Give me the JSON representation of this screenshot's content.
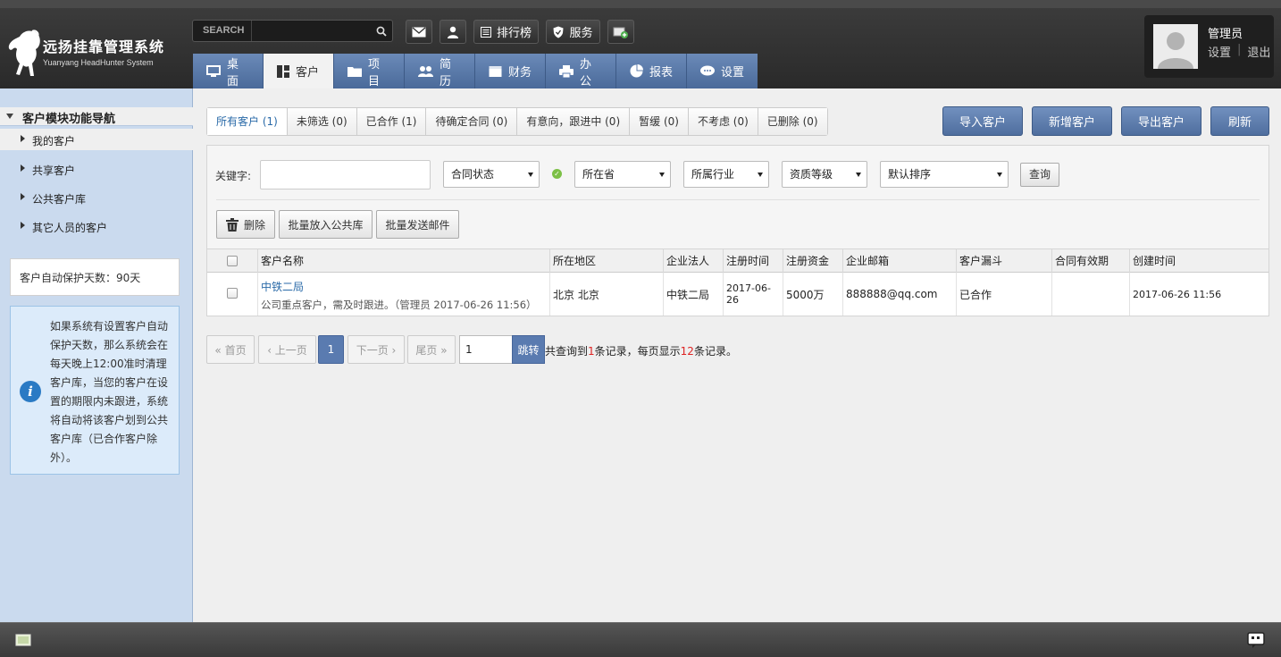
{
  "brand": {
    "title": "远扬挂靠管理系统",
    "subtitle": "Yuanyang HeadHunter System"
  },
  "search": {
    "label": "SEARCH",
    "value": ""
  },
  "top_buttons": [
    {
      "label": "",
      "icon": "mail-icon"
    },
    {
      "label": "",
      "icon": "user-icon"
    },
    {
      "label": "排行榜",
      "icon": "ranking-icon"
    },
    {
      "label": "服务",
      "icon": "shield-icon"
    },
    {
      "label": "",
      "icon": "add-screen-icon"
    }
  ],
  "user": {
    "name": "管理员",
    "settings": "设置",
    "logout": "退出"
  },
  "mainnav": [
    {
      "label": "桌面",
      "icon": "monitor-icon"
    },
    {
      "label": "客户",
      "icon": "grid-icon",
      "active": true
    },
    {
      "label": "项目",
      "icon": "folder-icon"
    },
    {
      "label": "简历",
      "icon": "users-icon"
    },
    {
      "label": "财务",
      "icon": "calendar-icon"
    },
    {
      "label": "办公",
      "icon": "printer-icon"
    },
    {
      "label": "报表",
      "icon": "pie-icon"
    },
    {
      "label": "设置",
      "icon": "chat-icon"
    }
  ],
  "sidebar": {
    "heading": "客户模块功能导航",
    "items": [
      "我的客户",
      "共享客户",
      "公共客户库",
      "其它人员的客户"
    ],
    "protect_days": "客户自动保护天数：90天",
    "info": "如果系统有设置客户自动保护天数，那么系统会在每天晚上12:00准时清理客户库，当您的客户在设置的期限内未跟进，系统将自动将该客户划到公共客户库（已合作客户除外）。"
  },
  "filter_tabs": [
    {
      "label": "所有客户 (1)",
      "active": true
    },
    {
      "label": "未筛选 (0)"
    },
    {
      "label": "已合作 (1)"
    },
    {
      "label": "待确定合同 (0)"
    },
    {
      "label": "有意向，跟进中 (0)"
    },
    {
      "label": "暂缓 (0)"
    },
    {
      "label": "不考虑 (0)"
    },
    {
      "label": "已删除 (0)"
    }
  ],
  "actions": {
    "import": "导入客户",
    "add": "新增客户",
    "export": "导出客户",
    "refresh": "刷新"
  },
  "filters": {
    "keyword_label": "关键字:",
    "keyword_value": "",
    "contract_status": "合同状态",
    "province": "所在省",
    "industry": "所属行业",
    "qualification": "资质等级",
    "sort": "默认排序",
    "query": "查询"
  },
  "bulk": {
    "delete": "删除",
    "to_public": "批量放入公共库",
    "send_mail": "批量发送邮件"
  },
  "table": {
    "headers": [
      "客户名称",
      "所在地区",
      "企业法人",
      "注册时间",
      "注册资金",
      "企业邮箱",
      "客户漏斗",
      "合同有效期",
      "创建时间"
    ],
    "rows": [
      {
        "name": "中铁二局",
        "desc": "公司重点客户，需及时跟进。（管理员 2017-06-26 11:56）",
        "region": "北京  北京",
        "legal": "中铁二局",
        "reg_date": "2017-06-26",
        "capital": "5000万",
        "email": "888888@qq.com",
        "funnel": "已合作",
        "contract": "",
        "created": "2017-06-26 11:56"
      }
    ]
  },
  "pagination": {
    "first": "« 首页",
    "prev": "‹ 上一页",
    "current": "1",
    "next": "下一页 ›",
    "last": "尾页 »",
    "input": "1",
    "jump": "跳转",
    "info_prefix": "共查询到",
    "total": "1",
    "info_mid": "条记录，每页显示",
    "per_page": "12",
    "info_suffix": "条记录。"
  },
  "colors": {
    "nav_blue": "#5a7bb0",
    "sidebar_bg": "#cadaee",
    "header_dark": "#2e2e2e",
    "link": "#2a6aa8"
  }
}
